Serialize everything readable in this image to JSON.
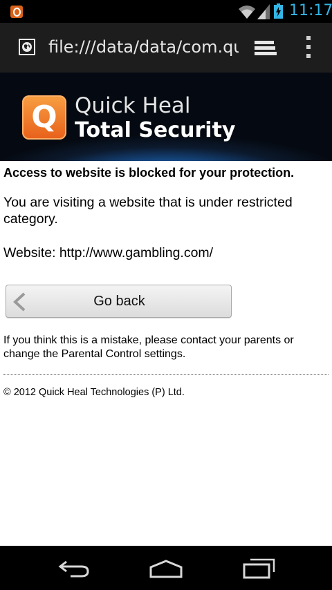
{
  "status_bar": {
    "time": "11:17",
    "notification_icon": "quick-heal-q-icon",
    "icons": [
      "wifi-icon",
      "cell-signal-icon",
      "battery-charging-icon"
    ],
    "clock_color": "#33b5e5"
  },
  "browser": {
    "url": "file:///data/data/com.qui",
    "site_icon": "globe-icon",
    "tabs_icon": "tabs-icon",
    "menu_icon": "overflow-menu-icon"
  },
  "banner": {
    "logo_letter": "Q",
    "brand_line1": "Quick Heal",
    "brand_line2": "Total Security",
    "accent_color": "#e8601a"
  },
  "page": {
    "heading": "Access to website is blocked for your protection.",
    "message": "You are visiting a website that is under restricted category.",
    "website_line": "Website: http://www.gambling.com/",
    "go_back_label": "Go back",
    "note": "If you think this is a mistake, please contact your parents or change the Parental Control settings.",
    "copyright": "© 2012 Quick Heal Technologies (P) Ltd."
  },
  "nav_bar": {
    "icons": [
      "back-icon",
      "home-icon",
      "recent-apps-icon"
    ]
  }
}
